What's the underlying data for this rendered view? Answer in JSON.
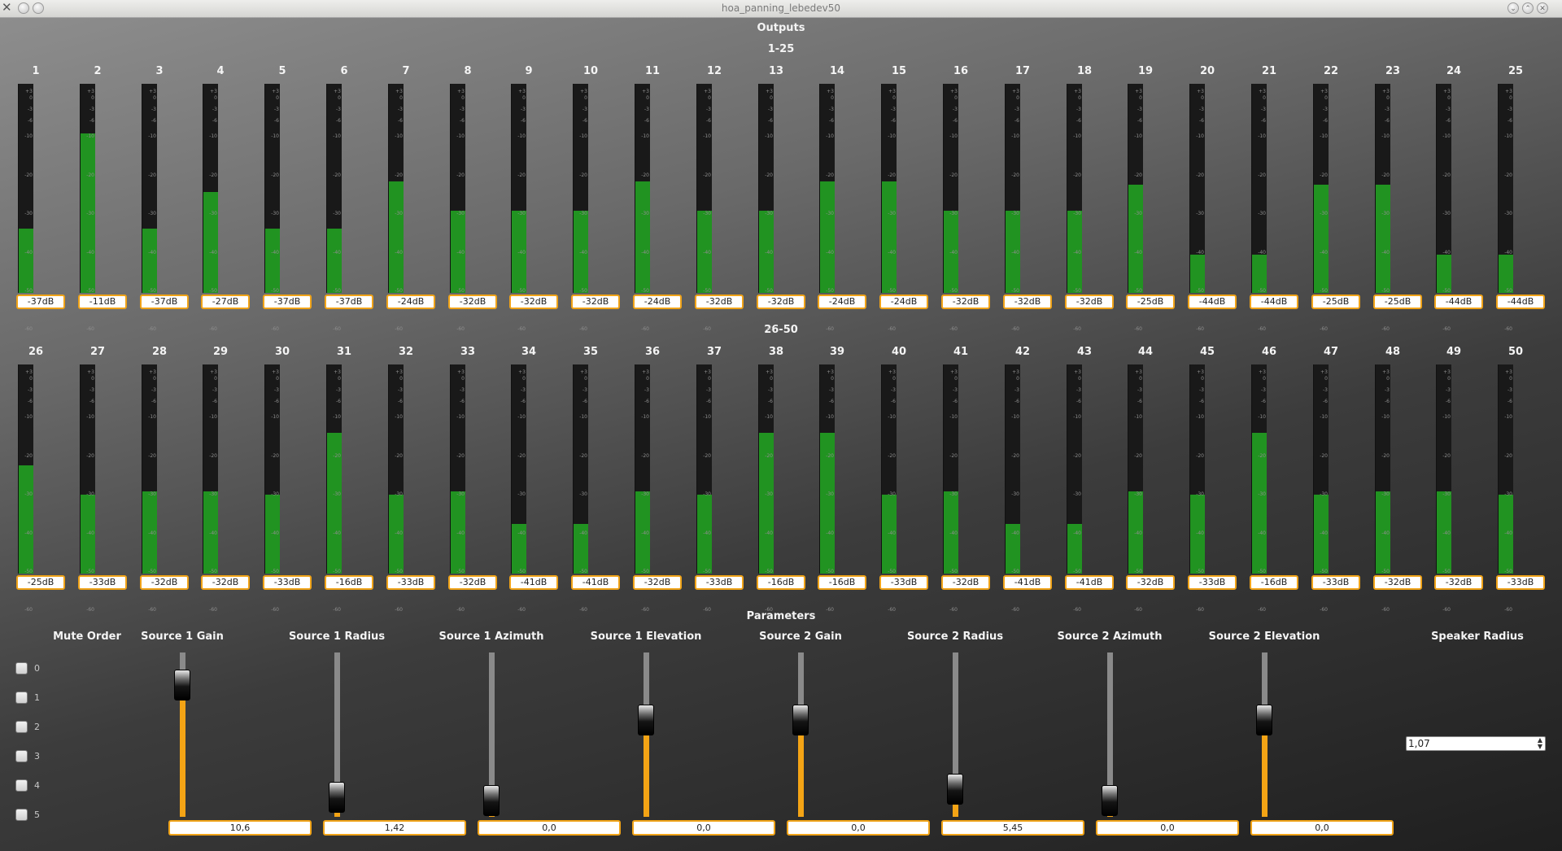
{
  "window": {
    "title": "hoa_panning_lebedev50",
    "close_glyph": "✕",
    "minimize_glyph": "⌄",
    "maximize_glyph": "⌃"
  },
  "outputs": {
    "header": "Outputs",
    "groups": [
      {
        "label": "1-25",
        "channels": [
          {
            "n": "1",
            "db": "-37dB",
            "level": -37
          },
          {
            "n": "2",
            "db": "-11dB",
            "level": -11
          },
          {
            "n": "3",
            "db": "-37dB",
            "level": -37
          },
          {
            "n": "4",
            "db": "-27dB",
            "level": -27
          },
          {
            "n": "5",
            "db": "-37dB",
            "level": -37
          },
          {
            "n": "6",
            "db": "-37dB",
            "level": -37
          },
          {
            "n": "7",
            "db": "-24dB",
            "level": -24
          },
          {
            "n": "8",
            "db": "-32dB",
            "level": -32
          },
          {
            "n": "9",
            "db": "-32dB",
            "level": -32
          },
          {
            "n": "10",
            "db": "-32dB",
            "level": -32
          },
          {
            "n": "11",
            "db": "-24dB",
            "level": -24
          },
          {
            "n": "12",
            "db": "-32dB",
            "level": -32
          },
          {
            "n": "13",
            "db": "-32dB",
            "level": -32
          },
          {
            "n": "14",
            "db": "-24dB",
            "level": -24
          },
          {
            "n": "15",
            "db": "-24dB",
            "level": -24
          },
          {
            "n": "16",
            "db": "-32dB",
            "level": -32
          },
          {
            "n": "17",
            "db": "-32dB",
            "level": -32
          },
          {
            "n": "18",
            "db": "-32dB",
            "level": -32
          },
          {
            "n": "19",
            "db": "-25dB",
            "level": -25
          },
          {
            "n": "20",
            "db": "-44dB",
            "level": -44
          },
          {
            "n": "21",
            "db": "-44dB",
            "level": -44
          },
          {
            "n": "22",
            "db": "-25dB",
            "level": -25
          },
          {
            "n": "23",
            "db": "-25dB",
            "level": -25
          },
          {
            "n": "24",
            "db": "-44dB",
            "level": -44
          },
          {
            "n": "25",
            "db": "-44dB",
            "level": -44
          }
        ]
      },
      {
        "label": "26-50",
        "channels": [
          {
            "n": "26",
            "db": "-25dB",
            "level": -25
          },
          {
            "n": "27",
            "db": "-33dB",
            "level": -33
          },
          {
            "n": "28",
            "db": "-32dB",
            "level": -32
          },
          {
            "n": "29",
            "db": "-32dB",
            "level": -32
          },
          {
            "n": "30",
            "db": "-33dB",
            "level": -33
          },
          {
            "n": "31",
            "db": "-16dB",
            "level": -16
          },
          {
            "n": "32",
            "db": "-33dB",
            "level": -33
          },
          {
            "n": "33",
            "db": "-32dB",
            "level": -32
          },
          {
            "n": "34",
            "db": "-41dB",
            "level": -41
          },
          {
            "n": "35",
            "db": "-41dB",
            "level": -41
          },
          {
            "n": "36",
            "db": "-32dB",
            "level": -32
          },
          {
            "n": "37",
            "db": "-33dB",
            "level": -33
          },
          {
            "n": "38",
            "db": "-16dB",
            "level": -16
          },
          {
            "n": "39",
            "db": "-16dB",
            "level": -16
          },
          {
            "n": "40",
            "db": "-33dB",
            "level": -33
          },
          {
            "n": "41",
            "db": "-32dB",
            "level": -32
          },
          {
            "n": "42",
            "db": "-41dB",
            "level": -41
          },
          {
            "n": "43",
            "db": "-41dB",
            "level": -41
          },
          {
            "n": "44",
            "db": "-32dB",
            "level": -32
          },
          {
            "n": "45",
            "db": "-33dB",
            "level": -33
          },
          {
            "n": "46",
            "db": "-16dB",
            "level": -16
          },
          {
            "n": "47",
            "db": "-33dB",
            "level": -33
          },
          {
            "n": "48",
            "db": "-32dB",
            "level": -32
          },
          {
            "n": "49",
            "db": "-32dB",
            "level": -32
          },
          {
            "n": "50",
            "db": "-33dB",
            "level": -33
          }
        ]
      }
    ],
    "meter_ticks": [
      "+3",
      "0",
      "-3",
      "-6",
      "-10",
      "-20",
      "-30",
      "-40",
      "-50",
      "-60"
    ]
  },
  "parameters": {
    "header": "Parameters",
    "mute_order": {
      "label": "Mute Order",
      "options": [
        "0",
        "1",
        "2",
        "3",
        "4",
        "5"
      ]
    },
    "sliders": [
      {
        "label": "Source 1 Gain",
        "value": "10,6",
        "fraction": 0.8
      },
      {
        "label": "Source 1 Radius",
        "value": "1,42",
        "fraction": 0.12
      },
      {
        "label": "Source 1 Azimuth",
        "value": "0,0",
        "fraction": 0.1
      },
      {
        "label": "Source 1 Elevation",
        "value": "0,0",
        "fraction": 0.59
      },
      {
        "label": "Source 2 Gain",
        "value": "0,0",
        "fraction": 0.59
      },
      {
        "label": "Source 2 Radius",
        "value": "5,45",
        "fraction": 0.17
      },
      {
        "label": "Source 2 Azimuth",
        "value": "0,0",
        "fraction": 0.1
      },
      {
        "label": "Source 2 Elevation",
        "value": "0,0",
        "fraction": 0.59
      }
    ],
    "speaker_radius": {
      "label": "Speaker Radius",
      "value": "1,07"
    }
  },
  "colors": {
    "meter_green": "#219321",
    "accent_orange": "#f0a318",
    "slider_fill": "#f4a415"
  }
}
